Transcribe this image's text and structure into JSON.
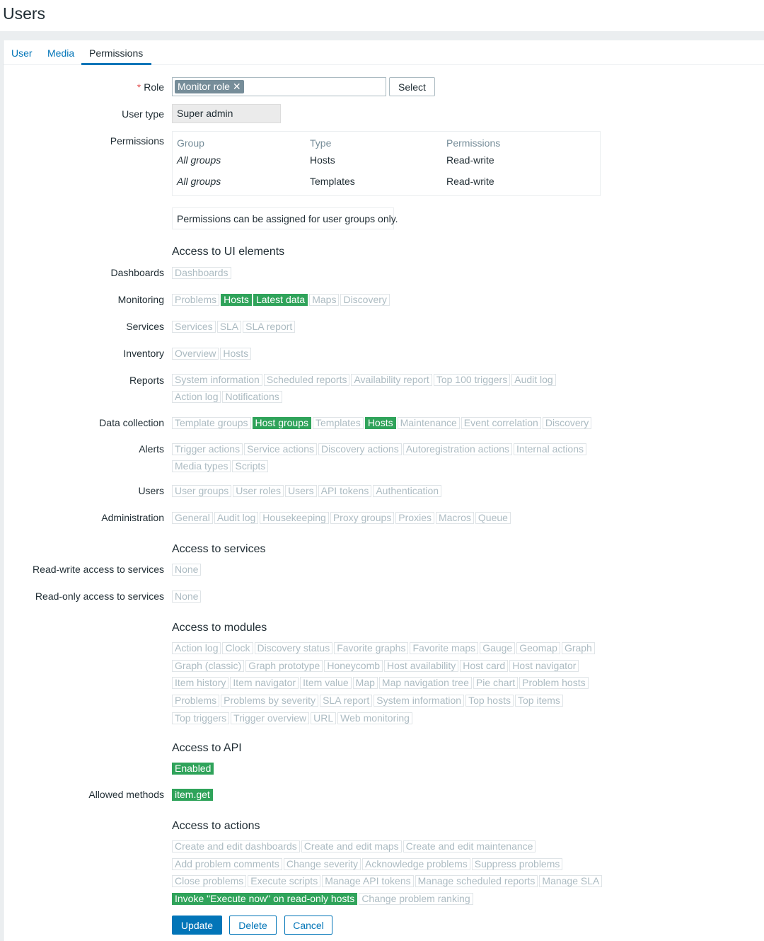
{
  "page": {
    "title": "Users"
  },
  "tabs": [
    {
      "label": "User",
      "active": false
    },
    {
      "label": "Media",
      "active": false
    },
    {
      "label": "Permissions",
      "active": true
    }
  ],
  "form": {
    "role_label": "Role",
    "role_required_mark": "*",
    "role_value": "Monitor role",
    "role_remove_icon": "close-icon",
    "select_button": "Select",
    "user_type_label": "User type",
    "user_type_value": "Super admin",
    "permissions_label": "Permissions",
    "permissions_table": {
      "headers": [
        "Group",
        "Type",
        "Permissions"
      ],
      "rows": [
        [
          "All groups",
          "Hosts",
          "Read-write"
        ],
        [
          "All groups",
          "Templates",
          "Read-write"
        ]
      ]
    },
    "permissions_info": "Permissions can be assigned for user groups only."
  },
  "ui_access": {
    "title": "Access to UI elements",
    "rows": [
      {
        "label": "Dashboards",
        "lines": [
          [
            {
              "t": "Dashboards",
              "on": false
            }
          ]
        ]
      },
      {
        "label": "Monitoring",
        "lines": [
          [
            {
              "t": "Problems",
              "on": false
            },
            {
              "t": "Hosts",
              "on": true
            },
            {
              "t": "Latest data",
              "on": true
            },
            {
              "t": "Maps",
              "on": false
            },
            {
              "t": "Discovery",
              "on": false
            }
          ]
        ]
      },
      {
        "label": "Services",
        "lines": [
          [
            {
              "t": "Services",
              "on": false
            },
            {
              "t": "SLA",
              "on": false
            },
            {
              "t": "SLA report",
              "on": false
            }
          ]
        ]
      },
      {
        "label": "Inventory",
        "lines": [
          [
            {
              "t": "Overview",
              "on": false
            },
            {
              "t": "Hosts",
              "on": false
            }
          ]
        ]
      },
      {
        "label": "Reports",
        "lines": [
          [
            {
              "t": "System information",
              "on": false
            },
            {
              "t": "Scheduled reports",
              "on": false
            },
            {
              "t": "Availability report",
              "on": false
            },
            {
              "t": "Top 100 triggers",
              "on": false
            },
            {
              "t": "Audit log",
              "on": false
            }
          ],
          [
            {
              "t": "Action log",
              "on": false
            },
            {
              "t": "Notifications",
              "on": false
            }
          ]
        ]
      },
      {
        "label": "Data collection",
        "lines": [
          [
            {
              "t": "Template groups",
              "on": false
            },
            {
              "t": "Host groups",
              "on": true
            },
            {
              "t": "Templates",
              "on": false
            },
            {
              "t": "Hosts",
              "on": true
            },
            {
              "t": "Maintenance",
              "on": false
            },
            {
              "t": "Event correlation",
              "on": false
            },
            {
              "t": "Discovery",
              "on": false
            }
          ]
        ]
      },
      {
        "label": "Alerts",
        "lines": [
          [
            {
              "t": "Trigger actions",
              "on": false
            },
            {
              "t": "Service actions",
              "on": false
            },
            {
              "t": "Discovery actions",
              "on": false
            },
            {
              "t": "Autoregistration actions",
              "on": false
            },
            {
              "t": "Internal actions",
              "on": false
            }
          ],
          [
            {
              "t": "Media types",
              "on": false
            },
            {
              "t": "Scripts",
              "on": false
            }
          ]
        ]
      },
      {
        "label": "Users",
        "lines": [
          [
            {
              "t": "User groups",
              "on": false
            },
            {
              "t": "User roles",
              "on": false
            },
            {
              "t": "Users",
              "on": false
            },
            {
              "t": "API tokens",
              "on": false
            },
            {
              "t": "Authentication",
              "on": false
            }
          ]
        ]
      },
      {
        "label": "Administration",
        "lines": [
          [
            {
              "t": "General",
              "on": false
            },
            {
              "t": "Audit log",
              "on": false
            },
            {
              "t": "Housekeeping",
              "on": false
            },
            {
              "t": "Proxy groups",
              "on": false
            },
            {
              "t": "Proxies",
              "on": false
            },
            {
              "t": "Macros",
              "on": false
            },
            {
              "t": "Queue",
              "on": false
            }
          ]
        ]
      }
    ]
  },
  "services_access": {
    "title": "Access to services",
    "rows": [
      {
        "label": "Read-write access to services",
        "lines": [
          [
            {
              "t": "None",
              "on": false
            }
          ]
        ]
      },
      {
        "label": "Read-only access to services",
        "lines": [
          [
            {
              "t": "None",
              "on": false
            }
          ]
        ]
      }
    ]
  },
  "modules_access": {
    "title": "Access to modules",
    "lines": [
      [
        {
          "t": "Action log",
          "on": false
        },
        {
          "t": "Clock",
          "on": false
        },
        {
          "t": "Discovery status",
          "on": false
        },
        {
          "t": "Favorite graphs",
          "on": false
        },
        {
          "t": "Favorite maps",
          "on": false
        },
        {
          "t": "Gauge",
          "on": false
        },
        {
          "t": "Geomap",
          "on": false
        },
        {
          "t": "Graph",
          "on": false
        }
      ],
      [
        {
          "t": "Graph (classic)",
          "on": false
        },
        {
          "t": "Graph prototype",
          "on": false
        },
        {
          "t": "Honeycomb",
          "on": false
        },
        {
          "t": "Host availability",
          "on": false
        },
        {
          "t": "Host card",
          "on": false
        },
        {
          "t": "Host navigator",
          "on": false
        }
      ],
      [
        {
          "t": "Item history",
          "on": false
        },
        {
          "t": "Item navigator",
          "on": false
        },
        {
          "t": "Item value",
          "on": false
        },
        {
          "t": "Map",
          "on": false
        },
        {
          "t": "Map navigation tree",
          "on": false
        },
        {
          "t": "Pie chart",
          "on": false
        },
        {
          "t": "Problem hosts",
          "on": false
        }
      ],
      [
        {
          "t": "Problems",
          "on": false
        },
        {
          "t": "Problems by severity",
          "on": false
        },
        {
          "t": "SLA report",
          "on": false
        },
        {
          "t": "System information",
          "on": false
        },
        {
          "t": "Top hosts",
          "on": false
        },
        {
          "t": "Top items",
          "on": false
        }
      ],
      [
        {
          "t": "Top triggers",
          "on": false
        },
        {
          "t": "Trigger overview",
          "on": false
        },
        {
          "t": "URL",
          "on": false
        },
        {
          "t": "Web monitoring",
          "on": false
        }
      ]
    ]
  },
  "api_access": {
    "title": "Access to API",
    "status": [
      {
        "t": "Enabled",
        "on": true
      }
    ],
    "methods_label": "Allowed methods",
    "methods": [
      {
        "t": "item.get",
        "on": true
      }
    ]
  },
  "actions_access": {
    "title": "Access to actions",
    "lines": [
      [
        {
          "t": "Create and edit dashboards",
          "on": false
        },
        {
          "t": "Create and edit maps",
          "on": false
        },
        {
          "t": "Create and edit maintenance",
          "on": false
        }
      ],
      [
        {
          "t": "Add problem comments",
          "on": false
        },
        {
          "t": "Change severity",
          "on": false
        },
        {
          "t": "Acknowledge problems",
          "on": false
        },
        {
          "t": "Suppress problems",
          "on": false
        }
      ],
      [
        {
          "t": "Close problems",
          "on": false
        },
        {
          "t": "Execute scripts",
          "on": false
        },
        {
          "t": "Manage API tokens",
          "on": false
        },
        {
          "t": "Manage scheduled reports",
          "on": false
        },
        {
          "t": "Manage SLA",
          "on": false
        }
      ],
      [
        {
          "t": "Invoke \"Execute now\" on read-only hosts",
          "on": true
        },
        {
          "t": "Change problem ranking",
          "on": false
        }
      ]
    ]
  },
  "buttons": {
    "update": "Update",
    "delete": "Delete",
    "cancel": "Cancel"
  },
  "colors": {
    "accent": "#0275b8",
    "enabled_tag": "#2fa35a",
    "disabled_tag_text": "#acbbc2",
    "required_mark": "#e45959"
  }
}
